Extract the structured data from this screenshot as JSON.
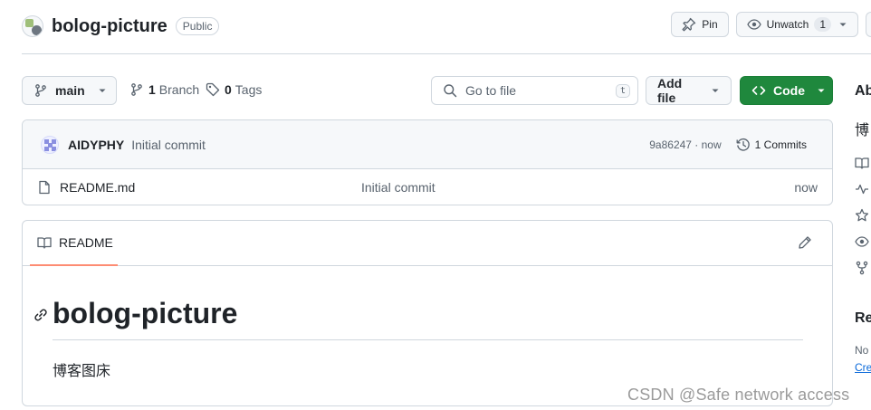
{
  "repo": {
    "name": "bolog-picture",
    "visibility": "Public"
  },
  "header_actions": {
    "pin_label": "Pin",
    "watch_label": "Unwatch",
    "watch_count": "1"
  },
  "toolbar": {
    "branch_name": "main",
    "branches_count": "1",
    "branches_label": "Branch",
    "tags_count": "0",
    "tags_label": "Tags",
    "goto_placeholder": "Go to file",
    "goto_shortcut": "t",
    "add_file_label": "Add file",
    "code_label": "Code"
  },
  "latest_commit": {
    "author": "AIDYPHY",
    "message": "Initial commit",
    "sha_time": "9a86247 · now",
    "commits_label": "1 Commits"
  },
  "files": [
    {
      "name": "README.md",
      "message": "Initial commit",
      "age": "now"
    }
  ],
  "readme": {
    "tab_label": "README",
    "heading": "bolog-picture",
    "paragraph": "博客图床"
  },
  "sidebar": {
    "about_title": "Ab",
    "description": "博",
    "releases_title": "Re",
    "releases_text": "No",
    "releases_link": "Cre"
  },
  "watermark": "CSDN @Safe network access",
  "colors": {
    "code_button": "#1f883d",
    "tab_underline": "#fd8c73",
    "border": "#d0d7de",
    "muted_text": "#59636e"
  },
  "icons": [
    "repo-avatar",
    "pin-icon",
    "eye-icon",
    "branch-icon",
    "tag-icon",
    "search-icon",
    "code-icon",
    "history-icon",
    "file-icon",
    "book-icon",
    "pencil-icon",
    "link-icon",
    "pulse-icon",
    "star-icon",
    "fork-icon"
  ]
}
